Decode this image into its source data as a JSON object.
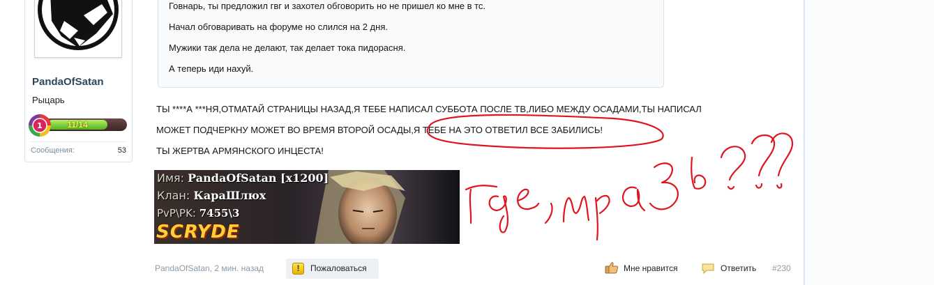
{
  "author": {
    "username": "PandaOfSatan",
    "title": "Рыцарь",
    "rank_level": "1",
    "rank_progress_text": "11/14",
    "rank_progress": 0.7857,
    "messages_label": "Сообщения:",
    "messages_count": "53"
  },
  "quote": {
    "lines": [
      "Говнарь, ты предложил гвг и захотел обговорить но не пришел ко мне в тс.",
      "Начал обговаривать на форуме но слился на 2 дня.",
      "Мужики так дела не делают, так делает тока пидорасня.",
      "А теперь иди нахуй."
    ]
  },
  "post": {
    "lines": [
      "ТЫ ****А ***НЯ,ОТМАТАЙ СТРАНИЦЫ НАЗАД,Я ТЕБЕ НАПИСАЛ СУББОТА ПОСЛЕ ТВ,ЛИБО МЕЖДУ ОСАДАМИ,ТЫ НАПИСАЛ",
      "МОЖЕТ ПОДЧЕРКНУ МОЖЕТ ВО ВРЕМЯ ВТОРОЙ ОСАДЫ,Я ТЕБЕ НА ЭТО ОТВЕТИЛ ВСЕ ЗАБИЛИСЬ!",
      "ТЫ ЖЕРТВА АРМЯНСКОГО ИНЦЕСТА!"
    ]
  },
  "signature": {
    "name_label": "Имя:",
    "name_value": "PandaOfSatan [x1200]",
    "clan_label": "Клан:",
    "clan_value": "КараШлюх",
    "pvp_label": "PvP\\PK:",
    "pvp_value": "7455\\3",
    "logo": "SCRYDE"
  },
  "annotation": {
    "handwritten_text": "где, мразь???",
    "color": "#e0141e"
  },
  "footer": {
    "author_time": "PandaOfSatan, 2 мин. назад",
    "report_label": "Пожаловаться",
    "like_label": "Мне нравится",
    "reply_label": "Ответить",
    "post_number": "#230"
  },
  "colors": {
    "username": "#2b485c",
    "border": "#d7e3ee",
    "muted": "#8a9aa8"
  }
}
